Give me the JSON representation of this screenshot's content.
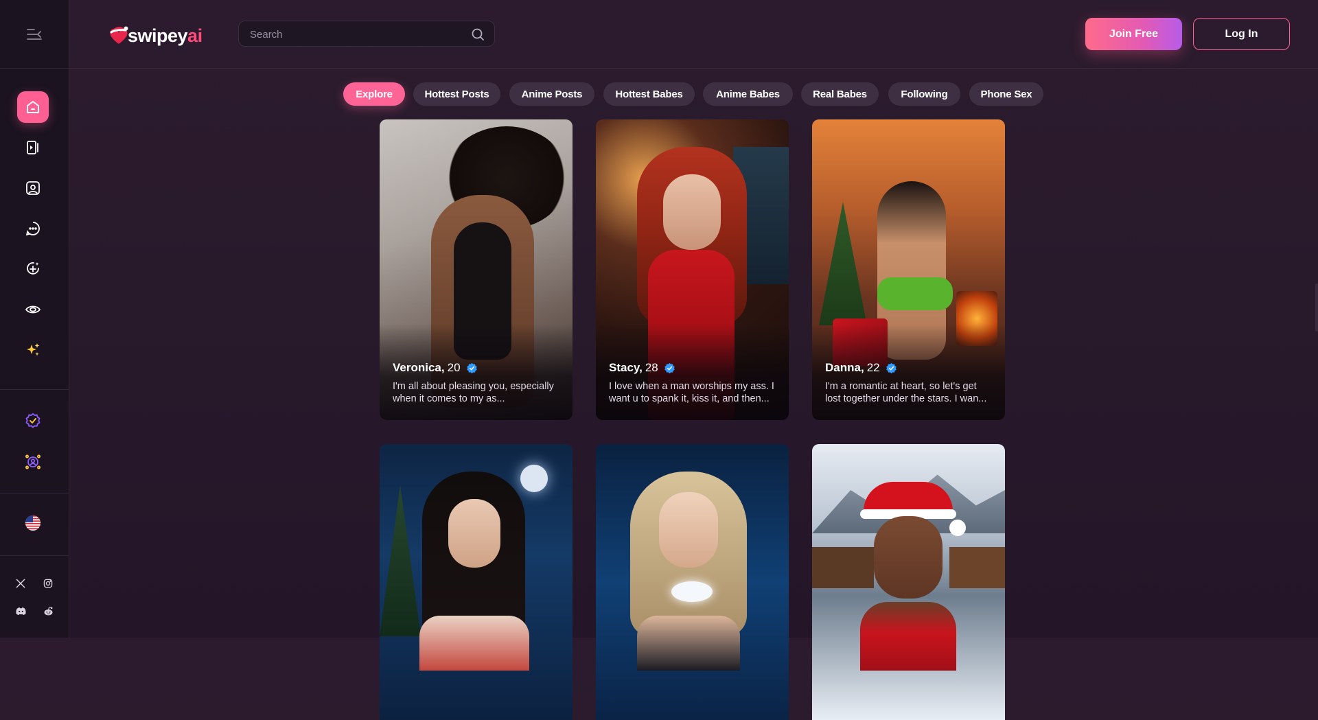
{
  "header": {
    "logo_main": "swipey",
    "logo_accent": "ai",
    "search_placeholder": "Search",
    "join_label": "Join Free",
    "login_label": "Log In"
  },
  "sidebar": {
    "items": [
      {
        "icon": "home-icon",
        "active": true
      },
      {
        "icon": "reels-icon"
      },
      {
        "icon": "gallery-icon"
      },
      {
        "icon": "chat-icon"
      },
      {
        "icon": "create-icon"
      },
      {
        "icon": "eye-icon"
      },
      {
        "icon": "sparkles-icon"
      },
      {
        "icon": "premium-badge-icon"
      },
      {
        "icon": "affiliate-icon"
      },
      {
        "icon": "us-flag-icon"
      }
    ],
    "social": [
      "x-icon",
      "instagram-icon",
      "discord-icon",
      "reddit-icon"
    ]
  },
  "tabs": [
    {
      "label": "Explore",
      "active": true
    },
    {
      "label": "Hottest Posts"
    },
    {
      "label": "Anime Posts"
    },
    {
      "label": "Hottest Babes"
    },
    {
      "label": "Anime Babes"
    },
    {
      "label": "Real Babes"
    },
    {
      "label": "Following"
    },
    {
      "label": "Phone Sex"
    }
  ],
  "cards": [
    {
      "name": "Veronica,",
      "age": "20",
      "desc": "I'm all about pleasing you, especially when it comes to my as..."
    },
    {
      "name": "Stacy,",
      "age": "28",
      "desc": "I love when a man worships my ass. I want u to spank it, kiss it, and then..."
    },
    {
      "name": "Danna,",
      "age": "22",
      "desc": "I'm a romantic at heart, so let's get lost together under the stars. I wan..."
    }
  ],
  "colors": {
    "accent": "#ff5f93",
    "background": "#2a1a2d",
    "sidebar": "#1b1320",
    "verified": "#2f9bff"
  }
}
